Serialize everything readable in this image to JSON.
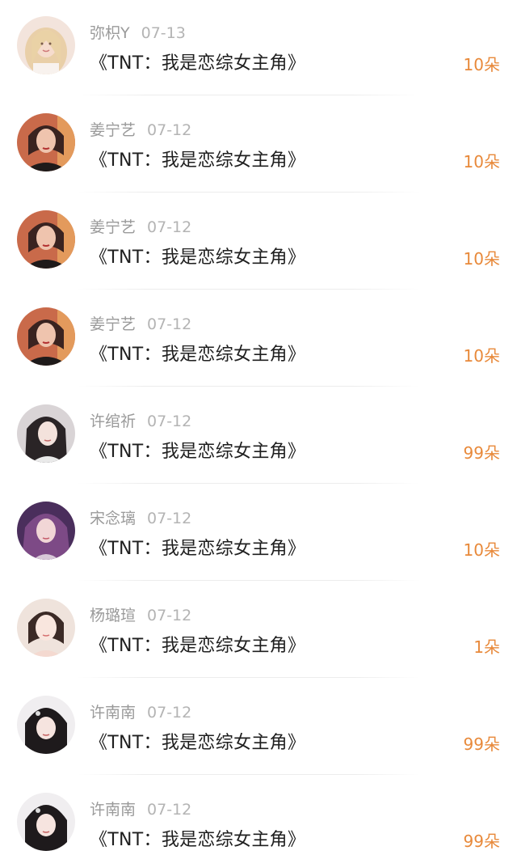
{
  "gift_list": {
    "items": [
      {
        "user": "弥枳Y",
        "date": "07-13",
        "title": "《TNT：我是恋综女主角》",
        "gift": "10朵",
        "avatar": "avatar-blonde"
      },
      {
        "user": "姜宁艺",
        "date": "07-12",
        "title": "《TNT：我是恋综女主角》",
        "gift": "10朵",
        "avatar": "avatar-redhair"
      },
      {
        "user": "姜宁艺",
        "date": "07-12",
        "title": "《TNT：我是恋综女主角》",
        "gift": "10朵",
        "avatar": "avatar-redhair"
      },
      {
        "user": "姜宁艺",
        "date": "07-12",
        "title": "《TNT：我是恋综女主角》",
        "gift": "10朵",
        "avatar": "avatar-redhair"
      },
      {
        "user": "许绾祈",
        "date": "07-12",
        "title": "《TNT：我是恋综女主角》",
        "gift": "99朵",
        "avatar": "avatar-dark"
      },
      {
        "user": "宋念璃",
        "date": "07-12",
        "title": "《TNT：我是恋综女主角》",
        "gift": "10朵",
        "avatar": "avatar-purple"
      },
      {
        "user": "杨璐瑄",
        "date": "07-12",
        "title": "《TNT：我是恋综女主角》",
        "gift": "1朵",
        "avatar": "avatar-light"
      },
      {
        "user": "许南南",
        "date": "07-12",
        "title": "《TNT：我是恋综女主角》",
        "gift": "99朵",
        "avatar": "avatar-darkbangs"
      },
      {
        "user": "许南南",
        "date": "07-12",
        "title": "《TNT：我是恋综女主角》",
        "gift": "99朵",
        "avatar": "avatar-darkbangs"
      }
    ]
  },
  "colors": {
    "gift_accent": "#e8893a",
    "title_text": "#1f1f1f",
    "meta_text": "#9a9a9a"
  }
}
